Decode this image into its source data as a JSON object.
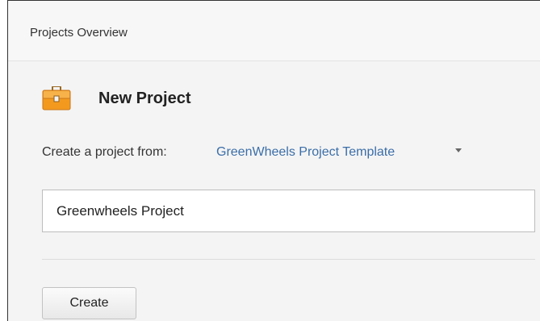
{
  "header": {
    "title": "Projects Overview"
  },
  "new_project": {
    "icon": "briefcase-icon",
    "title": "New Project",
    "create_from_label": "Create a project from:",
    "template_name": "GreenWheels Project Template",
    "project_name_value": "Greenwheels Project",
    "create_button_label": "Create"
  },
  "colors": {
    "link": "#3b6ea8",
    "icon_orange": "#f39a1e"
  }
}
